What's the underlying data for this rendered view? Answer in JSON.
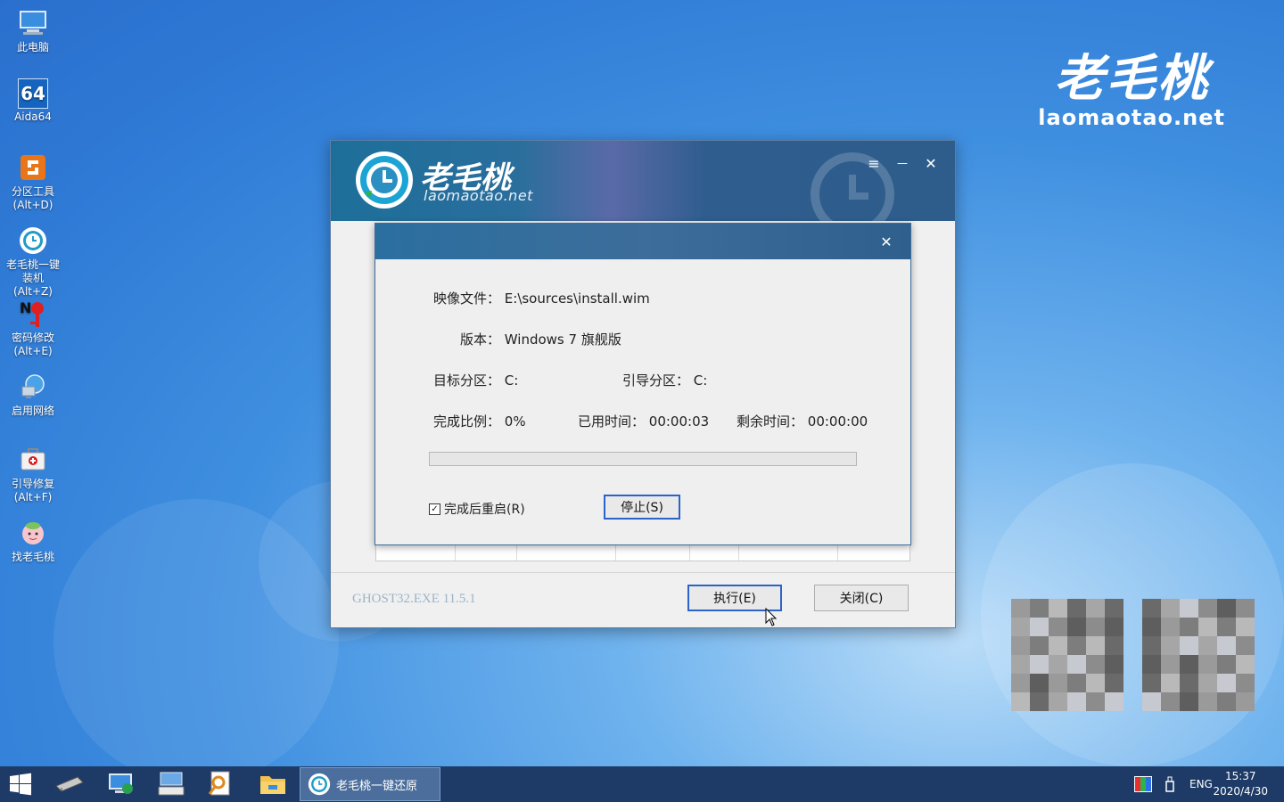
{
  "desktop": {
    "icons": [
      {
        "label": "此电脑"
      },
      {
        "label": "Aida64"
      },
      {
        "label": "分区工具\n(Alt+D)"
      },
      {
        "label": "老毛桃一键\n装机(Alt+Z)"
      },
      {
        "label": "密码修改\n(Alt+E)"
      },
      {
        "label": "启用网络"
      },
      {
        "label": "引导修复\n(Alt+F)"
      },
      {
        "label": "找老毛桃"
      }
    ],
    "aida_glyph": "64"
  },
  "brand": {
    "cn": "老毛桃",
    "en": "laomaotao.net"
  },
  "window": {
    "title_cn": "老毛桃",
    "title_en": "laomaotao.net",
    "menu_icon": "≡",
    "minimize_icon": "—",
    "close_icon": "✕",
    "version": "GHOST32.EXE 11.5.1",
    "execute_label": "执行(E)",
    "close_label": "关闭(C)"
  },
  "dialog": {
    "close_icon": "✕",
    "image_file_label": "映像文件：",
    "image_file_value": "E:\\sources\\install.wim",
    "version_label": "版本：",
    "version_value": "Windows 7 旗舰版",
    "target_label": "目标分区：",
    "target_value": "C:",
    "boot_label": "引导分区：",
    "boot_value": "C:",
    "ratio_label": "完成比例：",
    "ratio_value": "0%",
    "progress": 0,
    "elapsed_label": "已用时间：",
    "elapsed_value": "00:00:03",
    "remain_label": "剩余时间：",
    "remain_value": "00:00:00",
    "restart_label": "完成后重启(R)",
    "restart_checked": true,
    "checkmark": "✓",
    "stop_label": "停止(S)"
  },
  "taskbar": {
    "active_task": "老毛桃一键还原",
    "lang": "ENG",
    "time": "15:37",
    "date": "2020/4/30"
  }
}
